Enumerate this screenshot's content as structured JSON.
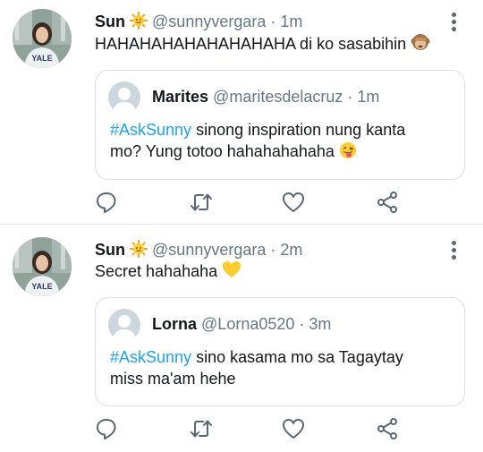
{
  "tweets": [
    {
      "author": {
        "name": "Sun",
        "handle": "@sunnyvergara",
        "emoji": "sun-emoji"
      },
      "time": "1m",
      "text": "HAHAHAHAHAHAHAHAHA di ko sasabihin",
      "text_emoji": "see-no-evil-monkey-emoji",
      "quote": {
        "name": "Marites",
        "handle": "@maritesdelacruz",
        "time": "1m",
        "hashtag": "#AskSunny",
        "line1": " sinong inspiration nung kanta",
        "line2": "mo? Yung totoo hahahahahaha",
        "line2_emoji": "winking-tongue-emoji"
      }
    },
    {
      "author": {
        "name": "Sun",
        "handle": "@sunnyvergara",
        "emoji": "sun-emoji"
      },
      "time": "2m",
      "text": "Secret hahahaha",
      "text_emoji": "yellow-heart-emoji",
      "quote": {
        "name": "Lorna",
        "handle": "@Lorna0520",
        "time": "3m",
        "hashtag": "#AskSunny",
        "line1": " sino kasama mo sa Tagaytay",
        "line2": "miss ma'am hehe",
        "line2_emoji": ""
      }
    }
  ],
  "separator": " · ",
  "icons": {
    "reply": "reply-icon",
    "retweet": "retweet-icon",
    "like": "like-icon",
    "share": "share-icon",
    "more": "more-options-icon"
  },
  "colors": {
    "hashtag": "#1da1f2",
    "handle": "#657786",
    "icon": "#5b6670",
    "border": "#d9e1e8"
  }
}
